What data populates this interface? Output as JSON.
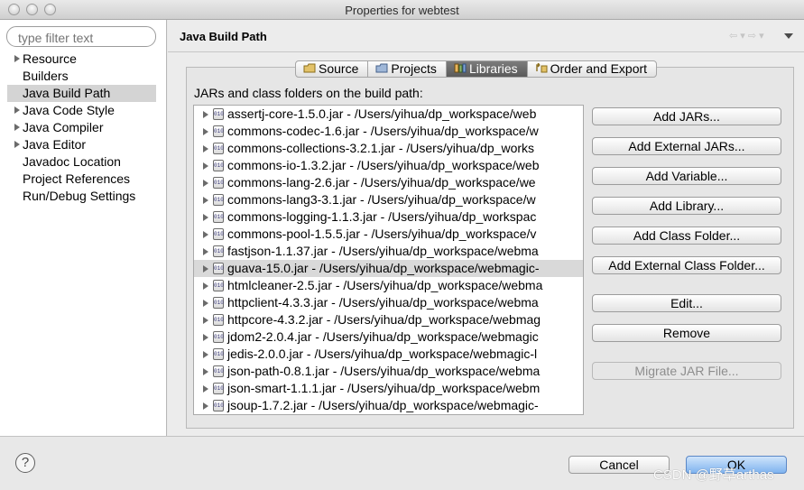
{
  "window": {
    "title": "Properties for webtest"
  },
  "filter": {
    "placeholder": "type filter text"
  },
  "nav": [
    {
      "label": "Resource",
      "expandable": true,
      "selected": false
    },
    {
      "label": "Builders",
      "expandable": false,
      "selected": false
    },
    {
      "label": "Java Build Path",
      "expandable": false,
      "selected": true
    },
    {
      "label": "Java Code Style",
      "expandable": true,
      "selected": false
    },
    {
      "label": "Java Compiler",
      "expandable": true,
      "selected": false
    },
    {
      "label": "Java Editor",
      "expandable": true,
      "selected": false
    },
    {
      "label": "Javadoc Location",
      "expandable": false,
      "selected": false
    },
    {
      "label": "Project References",
      "expandable": false,
      "selected": false
    },
    {
      "label": "Run/Debug Settings",
      "expandable": false,
      "selected": false
    }
  ],
  "page": {
    "title": "Java Build Path",
    "nav_arrows": "⇦ ▾ ⇨ ▾"
  },
  "tabs": [
    {
      "label": "Source",
      "active": false
    },
    {
      "label": "Projects",
      "active": false
    },
    {
      "label": "Libraries",
      "active": true
    },
    {
      "label": "Order and Export",
      "active": false
    }
  ],
  "libraries": {
    "label": "JARs and class folders on the build path:",
    "jar_icon_text": "010",
    "items": [
      {
        "text": "assertj-core-1.5.0.jar - /Users/yihua/dp_workspace/web",
        "selected": false
      },
      {
        "text": "commons-codec-1.6.jar - /Users/yihua/dp_workspace/w",
        "selected": false
      },
      {
        "text": "commons-collections-3.2.1.jar - /Users/yihua/dp_works",
        "selected": false
      },
      {
        "text": "commons-io-1.3.2.jar - /Users/yihua/dp_workspace/web",
        "selected": false
      },
      {
        "text": "commons-lang-2.6.jar - /Users/yihua/dp_workspace/we",
        "selected": false
      },
      {
        "text": "commons-lang3-3.1.jar - /Users/yihua/dp_workspace/w",
        "selected": false
      },
      {
        "text": "commons-logging-1.1.3.jar - /Users/yihua/dp_workspac",
        "selected": false
      },
      {
        "text": "commons-pool-1.5.5.jar - /Users/yihua/dp_workspace/v",
        "selected": false
      },
      {
        "text": "fastjson-1.1.37.jar - /Users/yihua/dp_workspace/webma",
        "selected": false
      },
      {
        "text": "guava-15.0.jar - /Users/yihua/dp_workspace/webmagic-",
        "selected": true
      },
      {
        "text": "htmlcleaner-2.5.jar - /Users/yihua/dp_workspace/webma",
        "selected": false
      },
      {
        "text": "httpclient-4.3.3.jar - /Users/yihua/dp_workspace/webma",
        "selected": false
      },
      {
        "text": "httpcore-4.3.2.jar - /Users/yihua/dp_workspace/webmag",
        "selected": false
      },
      {
        "text": "jdom2-2.0.4.jar - /Users/yihua/dp_workspace/webmagic",
        "selected": false
      },
      {
        "text": "jedis-2.0.0.jar - /Users/yihua/dp_workspace/webmagic-l",
        "selected": false
      },
      {
        "text": "json-path-0.8.1.jar - /Users/yihua/dp_workspace/webma",
        "selected": false
      },
      {
        "text": "json-smart-1.1.1.jar - /Users/yihua/dp_workspace/webm",
        "selected": false
      },
      {
        "text": "jsoup-1.7.2.jar - /Users/yihua/dp_workspace/webmagic-",
        "selected": false
      }
    ]
  },
  "buttons": {
    "add_jars": "Add JARs...",
    "add_external_jars": "Add External JARs...",
    "add_variable": "Add Variable...",
    "add_library": "Add Library...",
    "add_class_folder": "Add Class Folder...",
    "add_external_class_folder": "Add External Class Folder...",
    "edit": "Edit...",
    "remove": "Remove",
    "migrate_jar": "Migrate JAR File..."
  },
  "footer": {
    "help": "?",
    "cancel": "Cancel",
    "ok": "OK"
  },
  "watermark": "CSDN @野草arthas"
}
